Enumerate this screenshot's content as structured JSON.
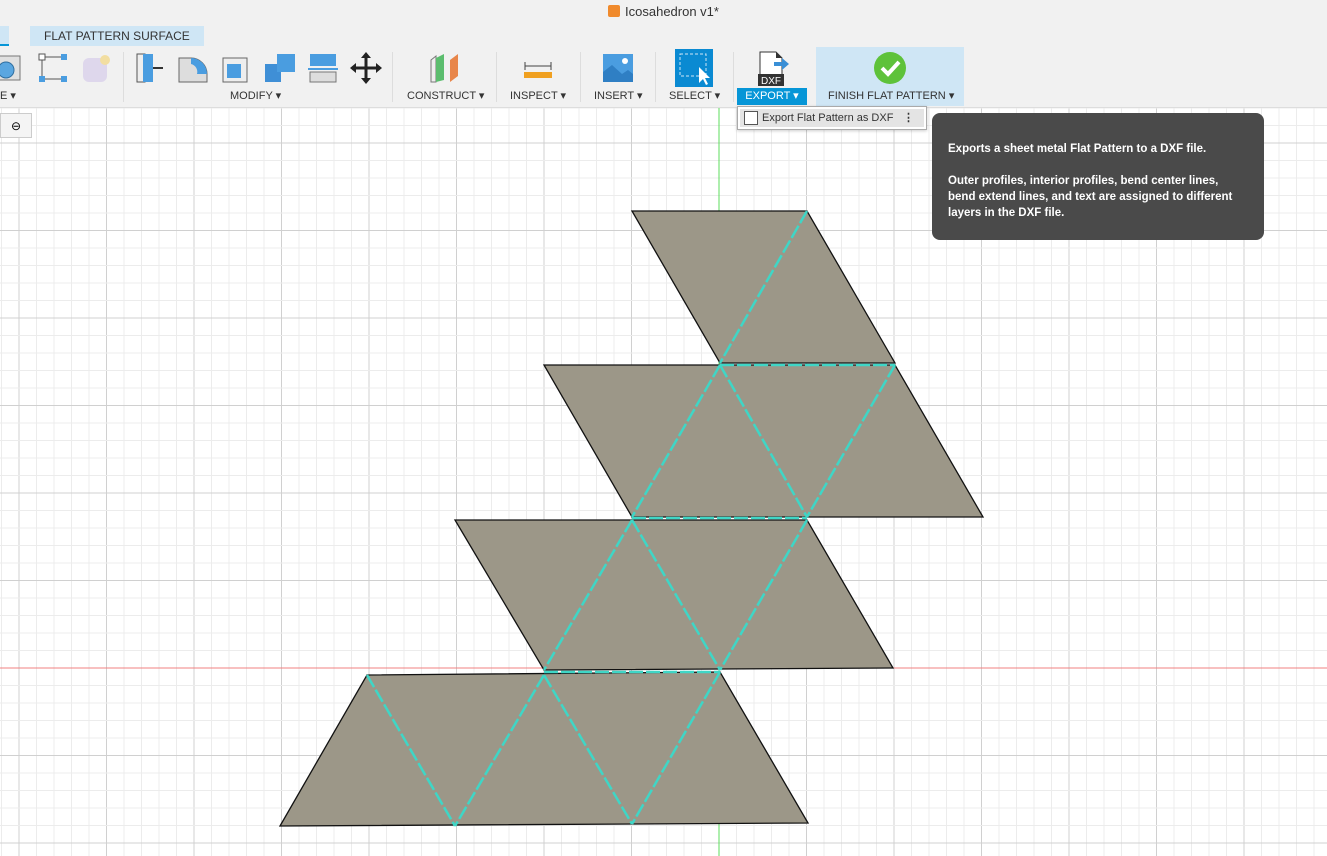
{
  "window": {
    "title": "Icosahedron v1*"
  },
  "tabs": [
    {
      "label": "FLAT PATTERN SURFACE"
    }
  ],
  "toolbar": {
    "create_label": "E",
    "modify_label": "MODIFY",
    "construct_label": "CONSTRUCT",
    "inspect_label": "INSPECT",
    "insert_label": "INSERT",
    "select_label": "SELECT",
    "export_label": "EXPORT",
    "finish_label": "FINISH FLAT PATTERN",
    "dxf_icon_text": "DXF"
  },
  "export_menu": {
    "items": [
      {
        "label": "Export Flat Pattern as DXF"
      }
    ]
  },
  "tooltip": {
    "line1": "Exports a sheet metal Flat Pattern to a DXF file.",
    "line2": "Outer profiles, interior profiles, bend center lines, bend extend lines, and text are assigned to different layers in the DXF file."
  },
  "colors": {
    "accent": "#0696d7",
    "face": "#9c9788",
    "bend_line": "#3fd6c6",
    "x_axis": "#f08080",
    "y_axis": "#5ddc5d"
  }
}
